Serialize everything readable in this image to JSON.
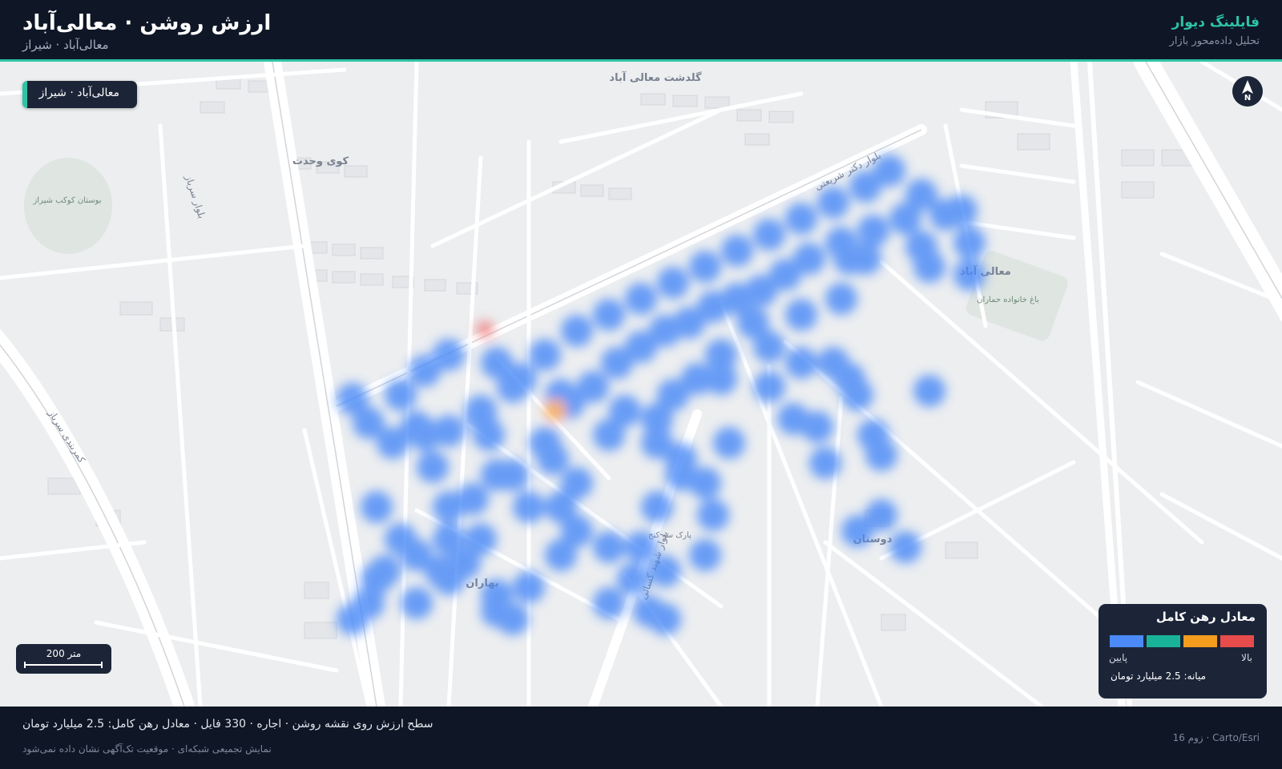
{
  "header": {
    "title": "ارزش روشن · معالی‌آباد",
    "subtitle": "معالی‌آباد · شیراز",
    "brand": "فایلینگ دیوار",
    "tagline": "تحلیل داده‌محور بازار"
  },
  "colors": {
    "accent": "#2ec4a6",
    "background": "#0f1726",
    "low": "#4b8af7",
    "mid": "#19b39a",
    "midHigh": "#f39c1e",
    "high": "#e84b4b"
  },
  "map": {
    "location_badge": "معالی‌آباد · شیراز",
    "compass_label": "N",
    "scale_label": "200 متر",
    "zoom": 16,
    "labels": {
      "golestan": "گلدشت معالی آباد",
      "kooye_vahdat": "کوی وحدت",
      "boostan_kookab": "بوستان کوکب شیراز",
      "maali_abad": "معالی آباد",
      "bagh": "باغ خانواده حماران",
      "dosstan": "دوستان",
      "baharan": "بهاران",
      "boulevard_shariati": "بلوار دکتر شریعتی",
      "boulevard_sarbaz": "بلوار سرباز",
      "boulevard_kasae": "بلوار شهید کسائی",
      "kamarbandi": "کمربندی سرباز",
      "sabze": "پارک سه کنج"
    }
  },
  "legend": {
    "title": "معادل رهن کامل",
    "low": "پایین",
    "high": "بالا",
    "median": "میانه: 2.5 میلیارد تومان"
  },
  "footer": {
    "summary": "سطح ارزش روی نقشه روشن · اجاره · 330 فایل · معادل رهن کامل: 2.5 میلیارد تومان",
    "note": "نمایش تجمیعی شبکه‌ای · موقعیت تک‌آگهی نشان داده نمی‌شود",
    "attribution": "زوم 16 · Carto/Esri"
  }
}
